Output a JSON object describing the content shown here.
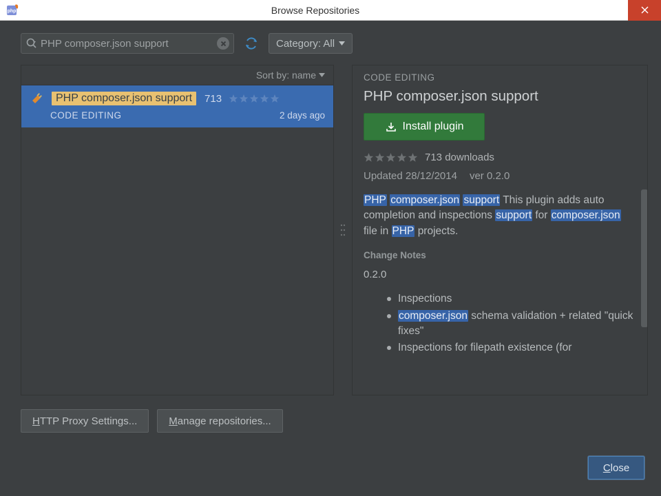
{
  "window": {
    "title": "Browse Repositories"
  },
  "toolbar": {
    "search_value": "PHP composer.json support",
    "category_label": "Category: All"
  },
  "sort": {
    "label": "Sort by: name"
  },
  "list": {
    "item": {
      "name": "PHP composer.json support",
      "downloads": "713",
      "category": "CODE EDITING",
      "age": "2 days ago"
    }
  },
  "details": {
    "category": "CODE EDITING",
    "title": "PHP composer.json support",
    "install_label": "Install plugin",
    "downloads_text": "713 downloads",
    "updated": "Updated 28/12/2014",
    "version": "ver 0.2.0",
    "desc_hl1": "PHP",
    "desc_hl2": "composer.json",
    "desc_hl3": "support",
    "desc_t1": " This plugin adds auto completion and inspections ",
    "desc_hl4": "support",
    "desc_t2": " for ",
    "desc_hl5": "composer.json",
    "desc_t3": " file in ",
    "desc_hl6": "PHP",
    "desc_t4": " projects.",
    "changenotes_heading": "Change Notes",
    "changenotes_version": "0.2.0",
    "bullets": {
      "b1": "Inspections",
      "b2_hl": "composer.json",
      "b2_rest": " schema validation + related \"quick fixes\"",
      "b3": "Inspections for filepath existence (for"
    }
  },
  "footer": {
    "proxy_label_pre": "H",
    "proxy_label_rest": "TTP Proxy Settings...",
    "manage_label_pre": "M",
    "manage_label_rest": "anage repositories...",
    "close_label_pre": "C",
    "close_label_rest": "lose"
  }
}
